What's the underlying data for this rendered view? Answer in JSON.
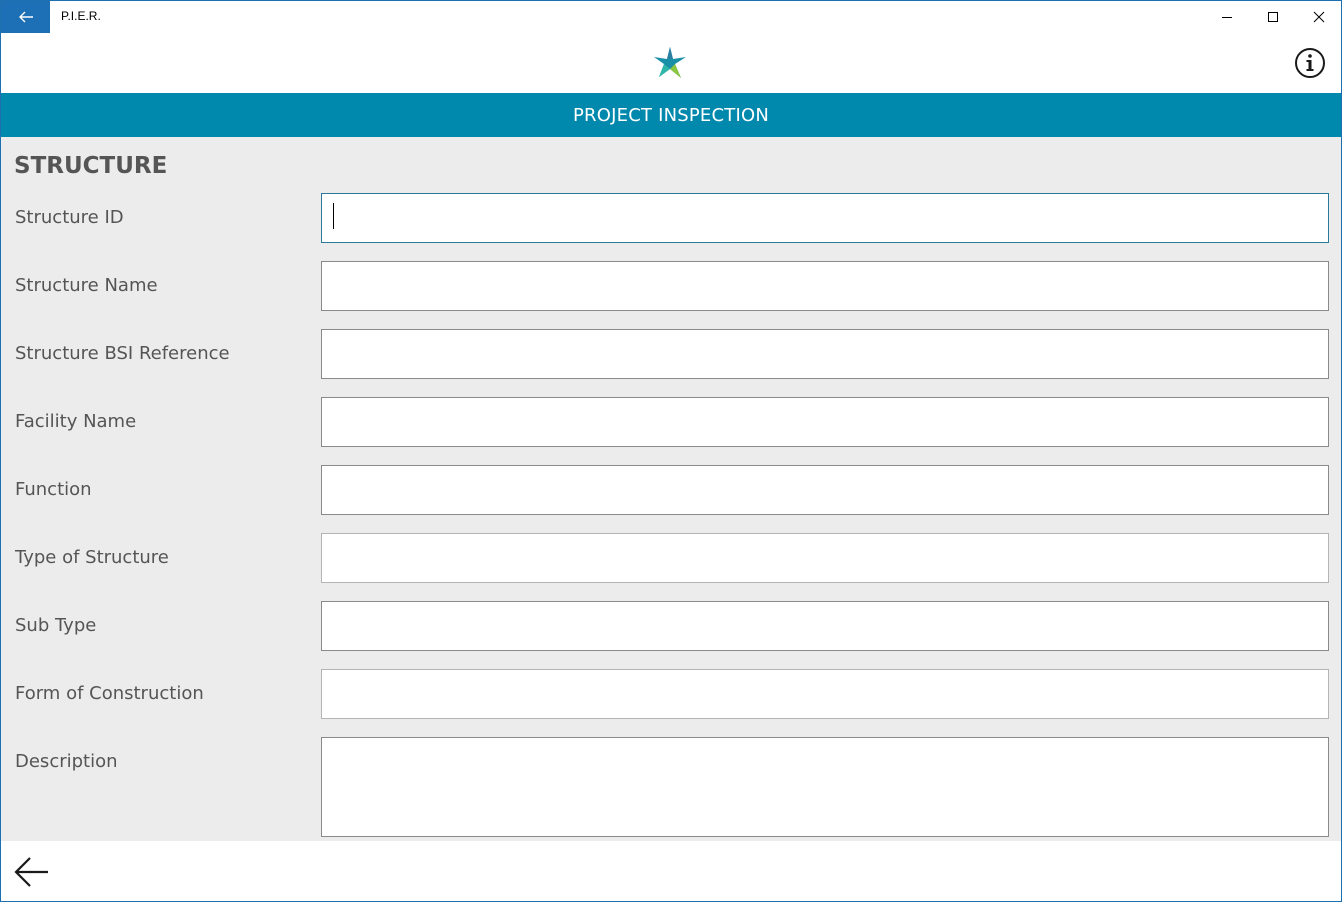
{
  "window": {
    "title": "P.I.E.R.",
    "accent_color": "#1d6fb6"
  },
  "header": {
    "logo_icon": "star-logo-icon",
    "info_icon": "info-icon"
  },
  "banner": {
    "title": "PROJECT INSPECTION",
    "color": "#0088ad"
  },
  "form": {
    "section_title": "STRUCTURE",
    "fields": [
      {
        "label": "Structure ID",
        "value": ""
      },
      {
        "label": "Structure Name",
        "value": ""
      },
      {
        "label": "Structure BSI Reference",
        "value": ""
      },
      {
        "label": "Facility Name",
        "value": ""
      },
      {
        "label": "Function",
        "value": ""
      },
      {
        "label": "Type of Structure",
        "value": ""
      },
      {
        "label": "Sub Type",
        "value": ""
      },
      {
        "label": "Form of Construction",
        "value": ""
      },
      {
        "label": "Description",
        "value": ""
      }
    ]
  },
  "footer": {
    "back_icon": "arrow-left-icon"
  }
}
